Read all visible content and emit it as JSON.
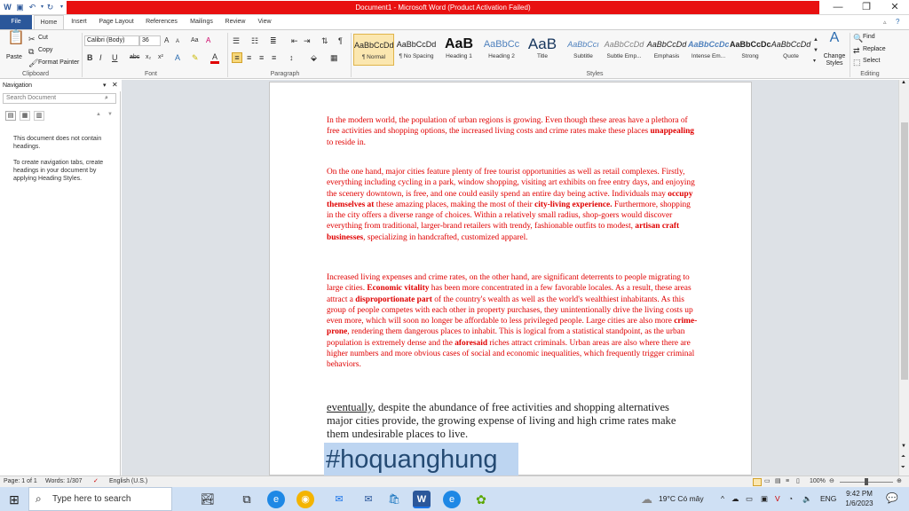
{
  "titlebar": {
    "title": "Document1 - Microsoft Word (Product Activation Failed)",
    "minimize": "—",
    "restore": "❐",
    "close": "✕"
  },
  "tabs": [
    "File",
    "Home",
    "Insert",
    "Page Layout",
    "References",
    "Mailings",
    "Review",
    "View"
  ],
  "ribbon": {
    "clipboard": {
      "paste": "Paste",
      "cut": "Cut",
      "copy": "Copy",
      "format_painter": "Format Painter",
      "label": "Clipboard"
    },
    "font": {
      "family": "Calibri (Body)",
      "size": "36",
      "label": "Font",
      "bold": "B",
      "italic": "I",
      "underline": "U",
      "strike": "abc",
      "sub": "x₂",
      "sup": "x²",
      "grow": "A",
      "shrink": "A",
      "case": "Aa",
      "clear": "A"
    },
    "paragraph": {
      "label": "Paragraph",
      "pilcrow": "¶"
    },
    "styles": {
      "label": "Styles",
      "items": [
        {
          "sample": "AaBbCcDd",
          "name": "¶ Normal"
        },
        {
          "sample": "AaBbCcDd",
          "name": "¶ No Spacing"
        },
        {
          "sample": "AaB",
          "name": "Heading 1"
        },
        {
          "sample": "AaBbCc",
          "name": "Heading 2"
        },
        {
          "sample": "AaB",
          "name": "Title"
        },
        {
          "sample": "AaBbCcı",
          "name": "Subtitle"
        },
        {
          "sample": "AaBbCcDd",
          "name": "Subtle Emp..."
        },
        {
          "sample": "AaBbCcDd",
          "name": "Emphasis"
        },
        {
          "sample": "AaBbCcDc",
          "name": "Intense Em..."
        },
        {
          "sample": "AaBbCcDc",
          "name": "Strong"
        },
        {
          "sample": "AaBbCcDd",
          "name": "Quote"
        }
      ],
      "change_styles": "Change Styles"
    },
    "editing": {
      "find": "Find",
      "replace": "Replace",
      "select": "Select",
      "label": "Editing"
    }
  },
  "navigation": {
    "title": "Navigation",
    "search_placeholder": "Search Document",
    "message1": "This document does not contain headings.",
    "message2": "To create navigation tabs, create headings in your document by applying Heading Styles."
  },
  "document": {
    "p1": "In the modern world, the population of urban regions is growing. Even though these areas have a plethora of free activities and shopping options, the increased living costs and crime rates make these places <b>unappealing</b> to reside in.",
    "p2": "On the one hand, major cities feature plenty of free tourist opportunities as well as retail complexes. Firstly, everything including cycling in a park, window shopping, visiting art exhibits on free entry days, and enjoying the scenery downtown, is free, and one could easily spend an entire day being active. Individuals may <b>occupy themselves at</b> these amazing places, making the most of their <b>city-living experience.</b> Furthermore, shopping in the city offers a diverse range of choices. Within a relatively small radius, shop-goers would discover everything from traditional, larger-brand retailers with trendy, fashionable outfits to modest, <b>artisan craft businesses</b>, specializing in handcrafted, customized apparel.",
    "p3": "Increased living expenses and crime rates, on the other hand, are significant deterrents to people migrating to large cities. <b>Economic vitality</b> has been more concentrated in a few favorable locales. As a result, these areas attract a <b>disproportionate part</b> of the country's wealth as well as the world's wealthiest inhabitants. As this group of people competes with each other in property purchases, they unintentionally drive the living costs up even more, which will soon no longer be affordable to less privileged people. Large cities are also more <b>crime-prone</b>, rendering them dangerous places to inhabit. This is logical from a statistical standpoint, as the urban population is extremely dense and the <b>aforesaid</b> riches attract criminals. Urban areas are also where there are higher numbers and more obvious cases of social and economic inequalities, which frequently trigger criminal behaviors.",
    "p4": "<u>eventually</u>, despite the abundance of free activities and shopping alternatives major cities provide, the growing expense of living and high crime rates make them undesirable places to live.",
    "hashtag": "#hoquanghung"
  },
  "statusbar": {
    "page": "Page: 1 of 1",
    "words": "Words: 1/307",
    "language": "English (U.S.)",
    "zoom": "100%"
  },
  "taskbar": {
    "search_placeholder": "Type here to search",
    "weather": "19°C  Có mây",
    "lang": "ENG",
    "time": "9:42 PM",
    "date": "1/6/2023"
  }
}
